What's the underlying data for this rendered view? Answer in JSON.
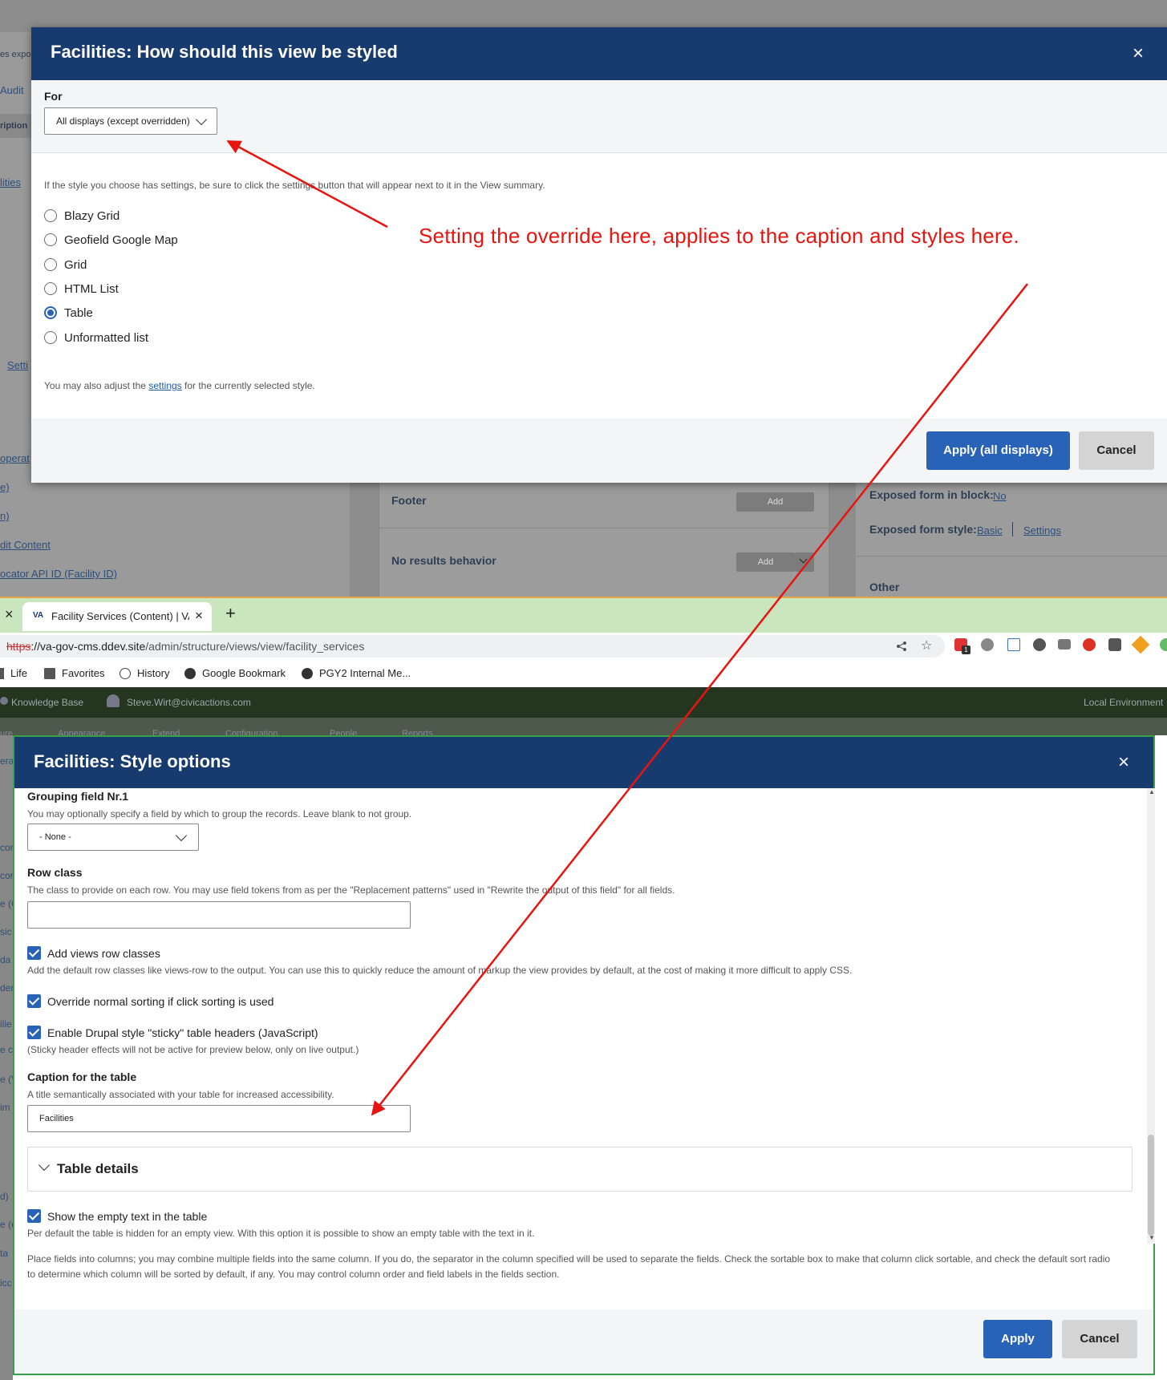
{
  "top_background": {
    "left_fragments": [
      "es expo",
      "Audit",
      "ription",
      "lities",
      "Setti",
      "operat",
      "e)",
      "n)",
      "dit Content",
      "ocator API ID (Facility ID)"
    ],
    "footer_label": "Footer",
    "footer_add": "Add",
    "no_results_label": "No results behavior",
    "no_results_add": "Add",
    "exposed_block_label": "Exposed form in block:",
    "exposed_block_value": "No",
    "exposed_style_label": "Exposed form style:",
    "exposed_style_value": "Basic",
    "exposed_style_settings": "Settings",
    "other_label": "Other"
  },
  "style_dialog": {
    "title": "Facilities: How should this view be styled",
    "close": "×",
    "for_label": "For",
    "for_value": "All displays (except overridden)",
    "hint": "If the style you choose has settings, be sure to click the settings button that will appear next to it in the View summary.",
    "options": [
      {
        "label": "Blazy Grid",
        "selected": false
      },
      {
        "label": "Geofield Google Map",
        "selected": false
      },
      {
        "label": "Grid",
        "selected": false
      },
      {
        "label": "HTML List",
        "selected": false
      },
      {
        "label": "Table",
        "selected": true
      },
      {
        "label": "Unformatted list",
        "selected": false
      }
    ],
    "adjust_prefix": "You may also adjust the ",
    "adjust_link": "settings",
    "adjust_suffix": " for the currently selected style.",
    "apply_button": "Apply (all displays)",
    "cancel_button": "Cancel"
  },
  "annotation": {
    "text": "Setting the override here, applies to the caption and styles here.",
    "color": "#e8140f"
  },
  "browser": {
    "tab_close": "×",
    "tab_favicon": "VA",
    "tab_title": "Facility Services (Content) | VA",
    "new_tab": "+",
    "url_scheme": "https",
    "url_host": "://va-gov-cms.ddev.site",
    "url_path": "/admin/structure/views/view/facility_services",
    "bookmarks": [
      "Life",
      "Favorites",
      "History",
      "Google Bookmark",
      "PGY2 Internal Me..."
    ],
    "extension_badge": "1"
  },
  "bg2": {
    "knowledge_base": "Knowledge Base",
    "user": "Steve.Wirt@civicactions.com",
    "environment": "Local Environment",
    "menu": [
      "ure",
      "Appearance",
      "Extend",
      "Configuration",
      "People",
      "Reports"
    ],
    "left_fragments": [
      "era",
      "cor",
      "cor",
      "e (C",
      "sic",
      "da",
      "der",
      "ilie",
      "e c",
      "e (V",
      "im",
      "d)",
      "e (e",
      "ta",
      "icc"
    ]
  },
  "options_dialog": {
    "title": "Facilities: Style options",
    "close": "×",
    "grouping_label": "Grouping field Nr.1",
    "grouping_desc": "You may optionally specify a field by which to group the records. Leave blank to not group.",
    "grouping_value": "- None -",
    "row_class_label": "Row class",
    "row_class_desc": "The class to provide on each row. You may use field tokens from as per the \"Replacement patterns\" used in \"Rewrite the output of this field\" for all fields.",
    "row_class_value": "",
    "add_row_classes_label": "Add views row classes",
    "add_row_classes_desc": "Add the default row classes like views-row to the output. You can use this to quickly reduce the amount of markup the view provides by default, at the cost of making it more difficult to apply CSS.",
    "override_sorting_label": "Override normal sorting if click sorting is used",
    "sticky_label": "Enable Drupal style \"sticky\" table headers (JavaScript)",
    "sticky_desc": "(Sticky header effects will not be active for preview below, only on live output.)",
    "caption_label": "Caption for the table",
    "caption_desc": "A title semantically associated with your table for increased accessibility.",
    "caption_value": "Facilities",
    "table_details": "Table details",
    "empty_text_label": "Show the empty text in the table",
    "empty_text_desc": "Per default the table is hidden for an empty view. With this option it is possible to show an empty table with the text in it.",
    "columns_desc_1": "Place fields into columns; you may combine multiple fields into the same column. If you do, the separator in the column specified will be used to separate the fields. Check the sortable box to make that column click sortable, and check the default sort radio",
    "columns_desc_2": "to determine which column will be sorted by default, if any. You may control column order and field labels in the fields section.",
    "apply_button": "Apply",
    "cancel_button": "Cancel"
  }
}
